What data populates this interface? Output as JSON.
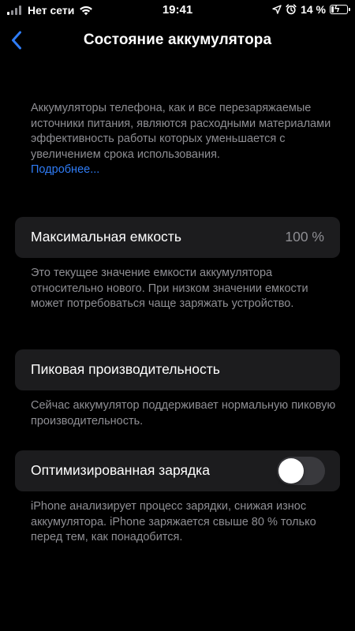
{
  "status_bar": {
    "carrier": "Нет сети",
    "time": "19:41",
    "battery_percent_text": "14 %",
    "battery_level": 0.14,
    "icons": [
      "signal-icon",
      "wifi-icon",
      "location-icon",
      "alarm-icon",
      "battery-charging-icon"
    ]
  },
  "nav": {
    "back_icon": "chevron-left-icon",
    "title": "Состояние аккумулятора"
  },
  "intro": {
    "text": "Аккумуляторы телефона, как и все перезаряжаемые источники питания, являются расходными материалами эффективность работы которых уменьшается с увеличением срока использования.",
    "link": "Подробнее..."
  },
  "max_capacity": {
    "label": "Максимальная емкость",
    "value": "100 %",
    "footnote": "Это текущее значение емкости аккумулятора относительно нового. При низком значении емкости может потребоваться чаще заряжать устройство."
  },
  "peak_performance": {
    "label": "Пиковая производительность",
    "footnote": "Сейчас аккумулятор поддерживает нормальную пиковую производительность."
  },
  "optimized_charging": {
    "label": "Оптимизированная зарядка",
    "enabled": false,
    "footnote": "iPhone анализирует процесс зарядки, снижая износ аккумулятора. iPhone заряжается свыше 80 % только перед тем, как понадобится."
  },
  "colors": {
    "background": "#000000",
    "cell": "#1c1c1e",
    "secondary_text": "#8e8e93",
    "link": "#2f7cf6",
    "toggle_off": "#39393d"
  }
}
